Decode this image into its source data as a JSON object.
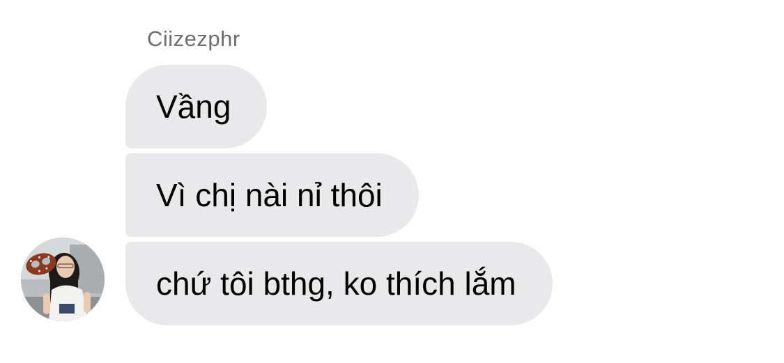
{
  "chat": {
    "sender_name": "Ciizezphr",
    "messages": [
      {
        "text": "Vầng"
      },
      {
        "text": "Vì chị nài nỉ thôi"
      },
      {
        "text": "chứ tôi bthg, ko thích lắm"
      }
    ]
  },
  "colors": {
    "bubble_background": "#e9e9eb",
    "sender_name": "#6c6c70",
    "message_text": "#000000"
  },
  "icons": {
    "avatar": "profile-photo"
  }
}
